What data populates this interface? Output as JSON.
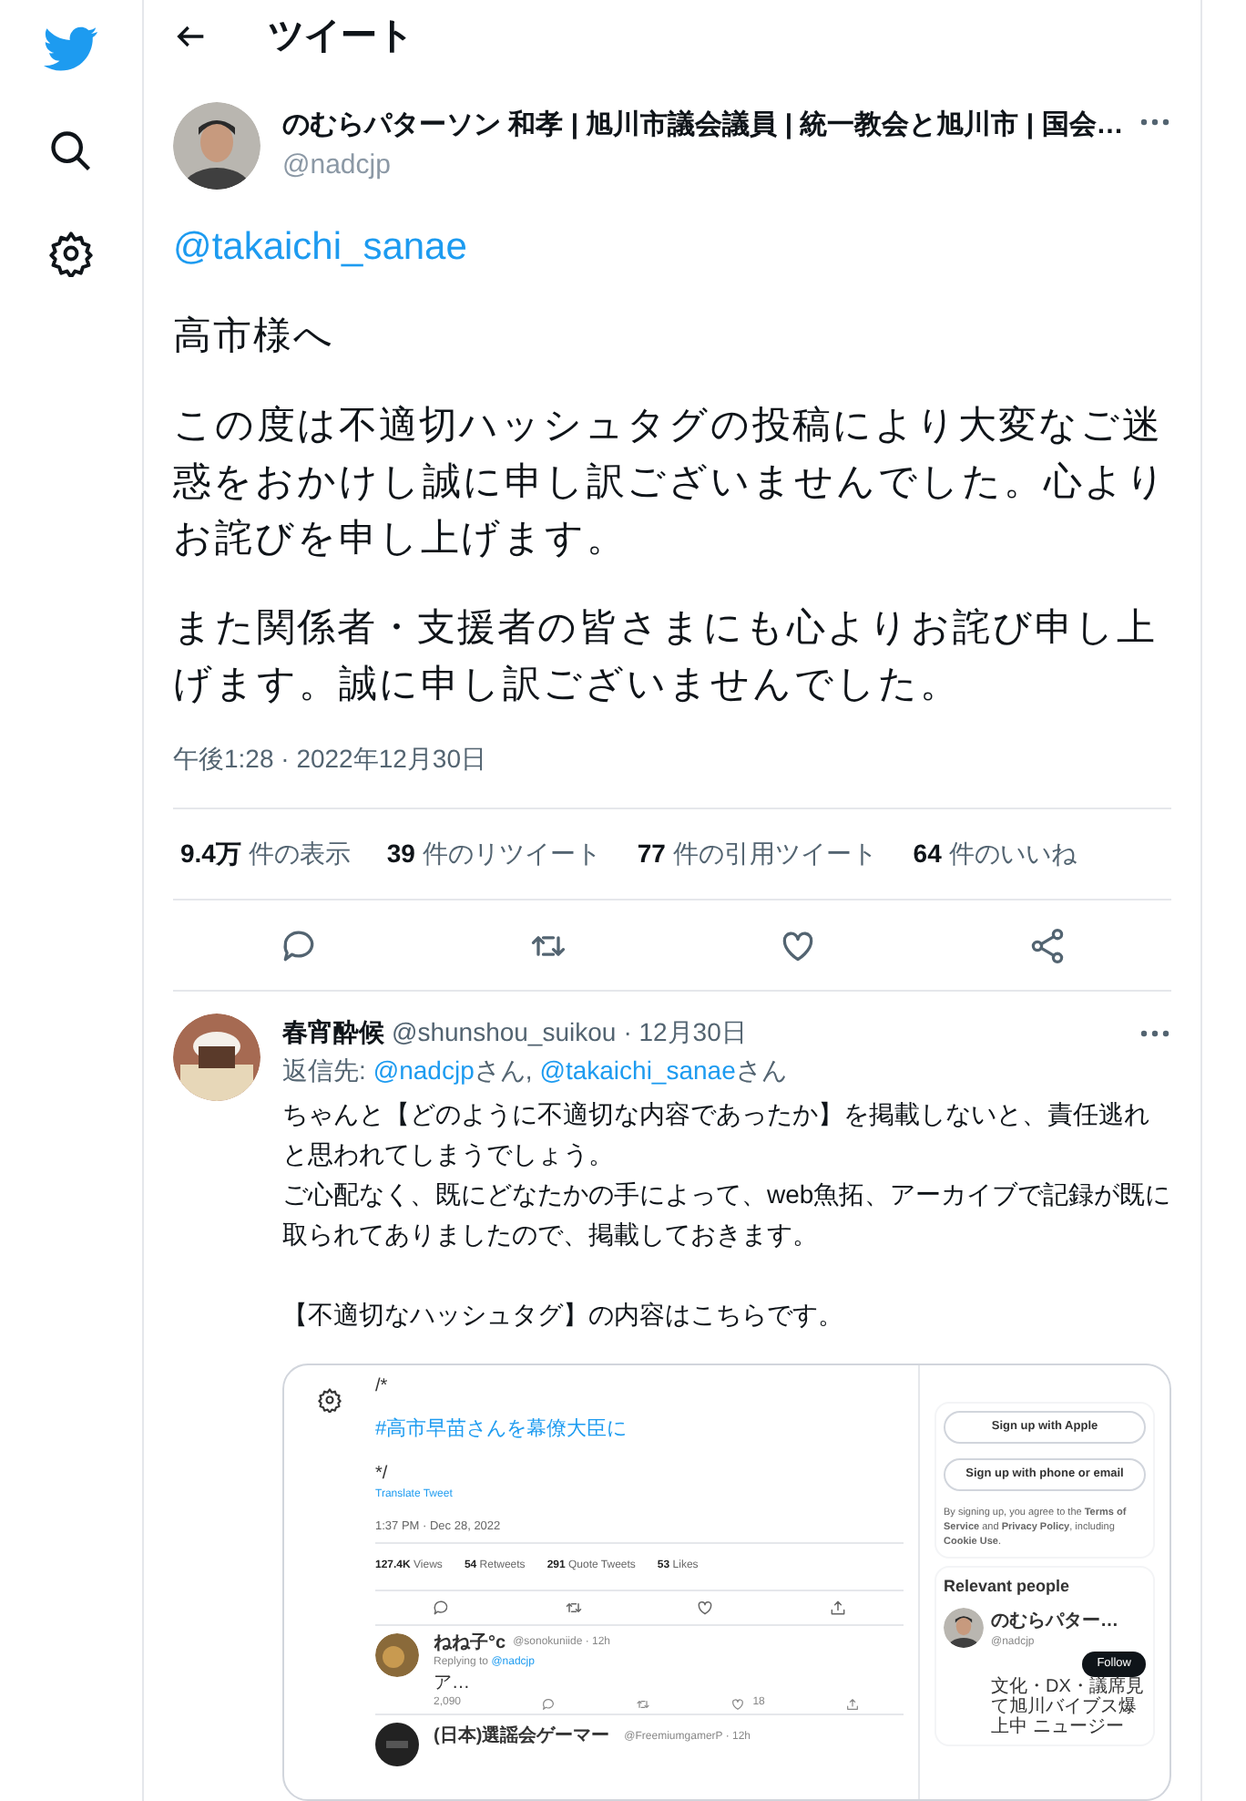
{
  "header": {
    "title": "ツイート"
  },
  "tweet": {
    "author_name": "のむらパターソン 和孝 | 旭川市議会議員 | 統一教会と旭川市 | 国会…",
    "handle": "@nadcjp",
    "mention": "@takaichi_sanae",
    "paragraphs": [
      "高市様へ",
      "この度は不適切ハッシュタグの投稿により大変なご迷惑をおかけし誠に申し訳ございませんでした。心よりお詫びを申し上げます。",
      "また関係者・支援者の皆さまにも心よりお詫び申し上げます。誠に申し訳ございませんでした。"
    ],
    "timestamp": "午後1:28 · 2022年12月30日",
    "stats": [
      {
        "number": "9.4万",
        "label": "件の表示"
      },
      {
        "number": "39",
        "label": "件のリツイート"
      },
      {
        "number": "77",
        "label": "件の引用ツイート"
      },
      {
        "number": "64",
        "label": "件のいいね"
      }
    ]
  },
  "reply": {
    "name": "春宵酔候",
    "handle": "@shunshou_suikou",
    "date": "· 12月30日",
    "reply_prefix": "返信先:",
    "reply_to": [
      {
        "handle": "@nadcjp",
        "suffix": "さん,"
      },
      {
        "handle": "@takaichi_sanae",
        "suffix": "さん"
      }
    ],
    "paragraphs": [
      [
        "ちゃんと【どのように不適切な内容であったか】を掲載しないと、責任逃れと思われてしまうでしょう。",
        "ご心配なく、既にどなたかの手によって、web魚拓、アーカイブで記録が既に取られてありましたので、掲載しておきます。"
      ],
      [
        "【不適切なハッシュタグ】の内容はこちらです。"
      ]
    ],
    "screenshot": {
      "code_open": "/*",
      "hashtag": "#高市早苗さんを幕僚大臣に",
      "code_close": "*/",
      "translate": "Translate Tweet",
      "timestamp": "1:37 PM · Dec 28, 2022",
      "stats": [
        {
          "number": "127.4K",
          "label": "Views"
        },
        {
          "number": "54",
          "label": "Retweets"
        },
        {
          "number": "291",
          "label": "Quote Tweets"
        },
        {
          "number": "53",
          "label": "Likes"
        }
      ],
      "replies": [
        {
          "name": "ねね子°c",
          "handle": "@sonokuniide · 12h",
          "replying_prefix": "Replying to",
          "replying_to": "@nadcjp",
          "text": "ア…",
          "views": "2,090",
          "likes": "18"
        },
        {
          "name": "(日本)選謡会ゲーマー",
          "handle": "@FreemiumgamerP · 12h"
        }
      ],
      "sign_up_apple": "Sign up with Apple",
      "sign_up_phone": "Sign up with phone or email",
      "terms": "By signing up, you agree to the **Terms of Service** and **Privacy Policy**, including **Cookie Use**.",
      "relevant_title": "Relevant people",
      "person": {
        "name": "のむらパター…",
        "handle": "@nadcjp",
        "follow": "Follow",
        "bio": "文化・DX・議席見て旭川バイブス爆上中 ニュージー"
      }
    }
  }
}
